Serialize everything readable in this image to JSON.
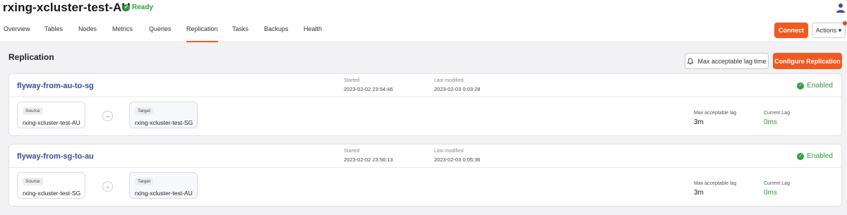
{
  "header": {
    "cluster_name": "rxing-xcluster-test-AU",
    "status": "Ready",
    "connect_label": "Connect",
    "actions_label": "Actions ▾"
  },
  "tabs": [
    {
      "label": "Overview"
    },
    {
      "label": "Tables"
    },
    {
      "label": "Nodes"
    },
    {
      "label": "Metrics"
    },
    {
      "label": "Queries"
    },
    {
      "label": "Replication",
      "active": true
    },
    {
      "label": "Tasks"
    },
    {
      "label": "Backups"
    },
    {
      "label": "Health"
    }
  ],
  "section": {
    "title": "Replication",
    "max_lag_button": "Max acceptable lag time",
    "configure_button": "Configure Replication"
  },
  "labels": {
    "started": "Started",
    "last_modified": "Last modified",
    "source": "Source",
    "target": "Target",
    "max_lag": "Max acceptable lag",
    "current_lag": "Current Lag"
  },
  "replications": [
    {
      "name": "flyway-from-au-to-sg",
      "started": "2023-02-02 23:54:46",
      "last_modified": "2023-02-03 0:03:28",
      "status": "Enabled",
      "source": "rxing-xcluster-test-AU",
      "target": "rxing-xcluster-test-SG",
      "max_lag": "3m",
      "current_lag": "0ms"
    },
    {
      "name": "flyway-from-sg-to-au",
      "started": "2023-02-02 23:56:13",
      "last_modified": "2023-02-03 0:05:36",
      "status": "Enabled",
      "source": "rxing-xcluster-test-SG",
      "target": "rxing-xcluster-test-AU",
      "max_lag": "3m",
      "current_lag": "0ms"
    }
  ],
  "colors": {
    "accent": "#f05a22",
    "success": "#2f9e3d",
    "link": "#3a4d99"
  },
  "icons": {
    "status": "check-circle-icon",
    "user": "user-icon",
    "bell": "bell-icon",
    "arrow": "arrow-right-icon"
  }
}
